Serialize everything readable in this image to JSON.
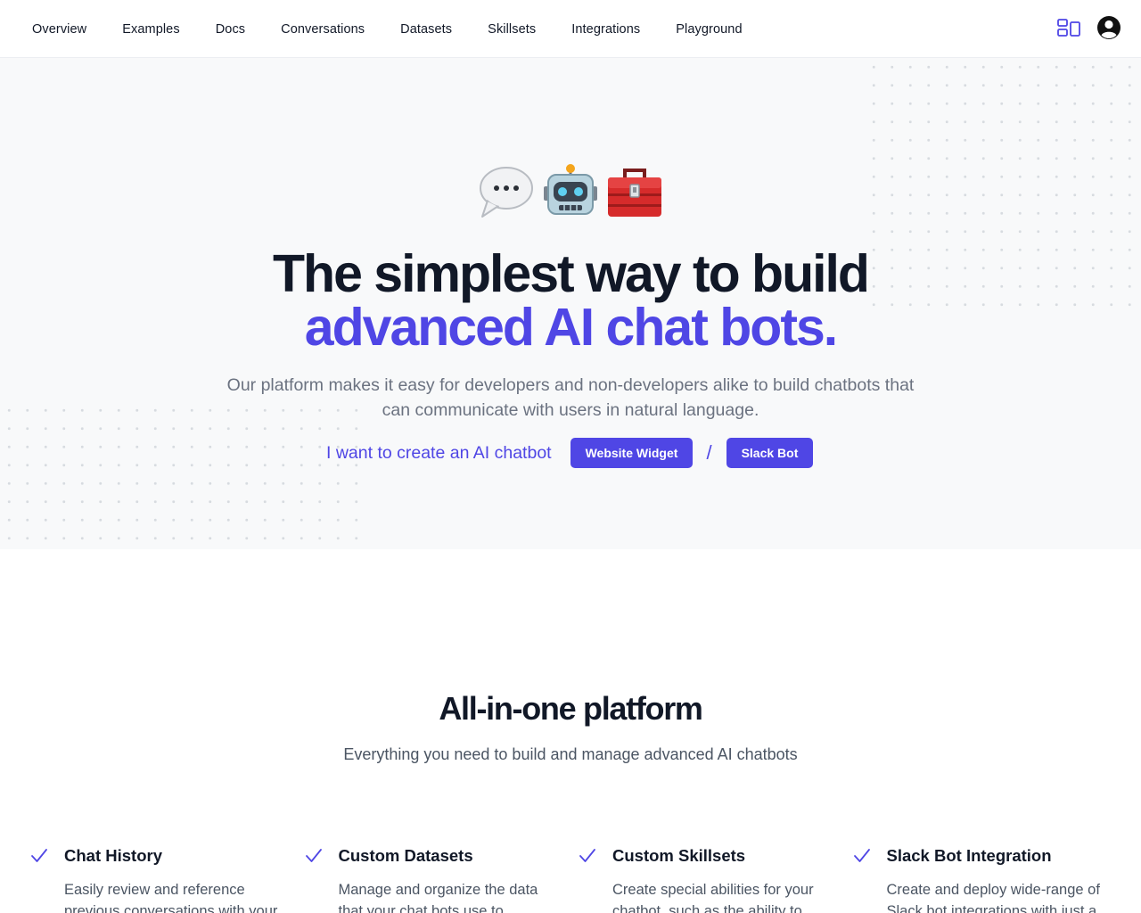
{
  "nav": {
    "links": [
      "Overview",
      "Examples",
      "Docs",
      "Conversations",
      "Datasets",
      "Skillsets",
      "Integrations",
      "Playground"
    ]
  },
  "hero": {
    "emojis": [
      "speech-bubble-emoji",
      "robot-emoji",
      "toolbox-emoji"
    ],
    "title_line1": "The simplest way to build",
    "title_line2": "advanced AI chat bots.",
    "subtitle": "Our platform makes it easy for developers and non-developers alike to build chatbots that can communicate with users in natural language.",
    "cta_lead": "I want to create an AI chatbot",
    "cta_widget": "Website Widget",
    "cta_separator": "/",
    "cta_slack": "Slack Bot"
  },
  "platform": {
    "title": "All-in-one platform",
    "subtitle": "Everything you need to build and manage advanced AI chatbots",
    "features": [
      {
        "title": "Chat History",
        "desc": "Easily review and reference previous conversations with your"
      },
      {
        "title": "Custom Datasets",
        "desc": "Manage and organize the data that your chat bots use to"
      },
      {
        "title": "Custom Skillsets",
        "desc": "Create special abilities for your chatbot, such as the ability to"
      },
      {
        "title": "Slack Bot Integration",
        "desc": "Create and deploy wide-range of Slack bot integrations with just a"
      }
    ]
  },
  "colors": {
    "accent": "#4f46e5",
    "text": "#111827",
    "muted": "#6b7280",
    "hero_bg": "#f8f9fa"
  }
}
